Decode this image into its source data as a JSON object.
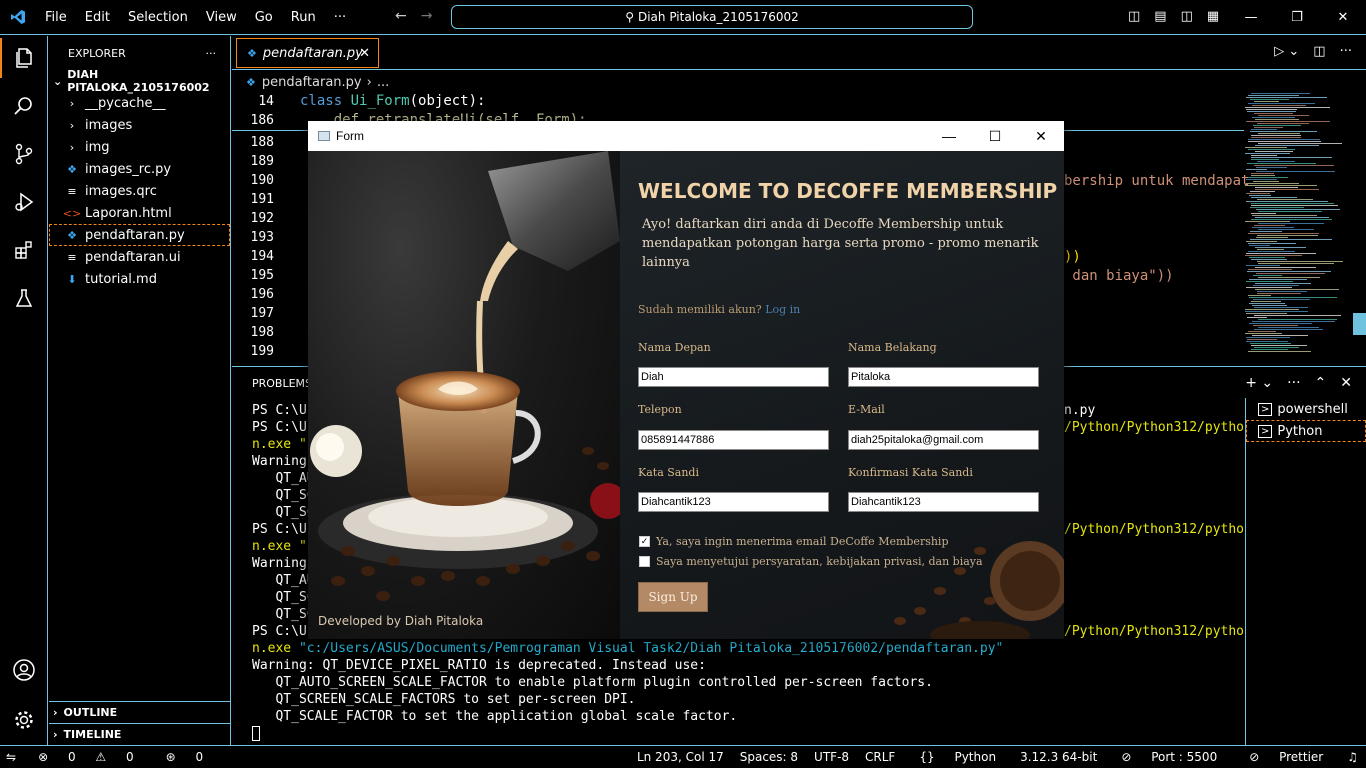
{
  "titlebar": {
    "menu": [
      "File",
      "Edit",
      "Selection",
      "View",
      "Go",
      "Run",
      "···"
    ],
    "search": "Diah Pitaloka_2105176002"
  },
  "explorer": {
    "header": "EXPLORER",
    "folder": "DIAH PITALOKA_2105176002",
    "items": [
      {
        "name": "__pycache__",
        "icon": "chevron-right"
      },
      {
        "name": "images",
        "icon": "chevron-right"
      },
      {
        "name": "img",
        "icon": "chevron-right"
      },
      {
        "name": "images_rc.py",
        "icon": "python"
      },
      {
        "name": "images.qrc",
        "icon": "lines"
      },
      {
        "name": "Laporan.html",
        "icon": "html"
      },
      {
        "name": "pendaftaran.py",
        "icon": "python"
      },
      {
        "name": "pendaftaran.ui",
        "icon": "lines"
      },
      {
        "name": "tutorial.md",
        "icon": "markdown"
      }
    ],
    "outline": "OUTLINE",
    "timeline": "TIMELINE"
  },
  "editor": {
    "tab": "pendaftaran.py",
    "breadcrumb_file": "pendaftaran.py",
    "breadcrumb_more": "...",
    "sticky": [
      {
        "line": "14",
        "code_kw": "class",
        "code_cls": "Ui_Form",
        "code_rest": "(object):"
      },
      {
        "line": "186",
        "code": "    def retranslateUi(self, Form):"
      }
    ],
    "lines": [
      "188",
      "189",
      "190",
      "191",
      "192",
      "193",
      "194",
      "195",
      "196",
      "197",
      "198",
      "199"
    ],
    "visible_code": {
      "l190": "bership untuk mendapat",
      "l194": "))",
      "l195": " dan biaya\"))"
    }
  },
  "panel": {
    "tab": "PROBLEMS",
    "terminal_left": [
      "PS C:\\Us",
      "PS C:\\Us",
      "n.exe \"c",
      "Warning:",
      "   QT_AU",
      "   QT_SC",
      "   QT_SC",
      "PS C:\\Us",
      "n.exe \"c",
      "Warning:",
      "   QT_AU",
      "   QT_SC",
      "   QT_SC",
      "PS C:\\Us"
    ],
    "terminal_right": {
      "r1": "n.py",
      "r2": "/Python/Python312/pytho",
      "r3": "/Python/Python312/pytho",
      "r4": "/Python/Python312/pytho"
    },
    "terminal_full": [
      "n.exe \"c:/Users/ASUS/Documents/Pemrograman Visual Task2/Diah Pitaloka_2105176002/pendaftaran.py\"",
      "Warning: QT_DEVICE_PIXEL_RATIO is deprecated. Instead use:",
      "   QT_AUTO_SCREEN_SCALE_FACTOR to enable platform plugin controlled per-screen factors.",
      "   QT_SCREEN_SCALE_FACTORS to set per-screen DPI.",
      "   QT_SCALE_FACTOR to set the application global scale factor."
    ],
    "terminals": [
      "powershell",
      "Python"
    ]
  },
  "status": {
    "errors": "0",
    "warnings": "0",
    "ports": "0",
    "position": "Ln 203, Col 17",
    "spaces": "Spaces: 8",
    "encoding": "UTF-8",
    "eol": "CRLF",
    "language": "Python",
    "interpreter": "3.12.3 64-bit",
    "port": "Port : 5500",
    "prettier": "Prettier"
  },
  "form": {
    "title": "Form",
    "heading": "WELCOME TO DECOFFE MEMBERSHIP",
    "subtitle_lines": [
      "Ayo! daftarkan diri anda di Decoffe Membership untuk",
      "mendapatkan potongan harga serta promo - promo menarik",
      "lainnya"
    ],
    "already_member": "Sudah memiliki akun?",
    "login_link": "Log in",
    "first_name_label": "Nama Depan",
    "first_name": "Diah",
    "last_name_label": "Nama Belakang",
    "last_name": "Pitaloka",
    "phone_label": "Telepon",
    "phone": "085891447886",
    "email_label": "E-Mail",
    "email": "diah25pitaloka@gmail.com",
    "password_label": "Kata Sandi",
    "password": "Diahcantik123",
    "confirm_label": "Konfirmasi Kata Sandi",
    "confirm": "Diahcantik123",
    "check_newsletter": "Ya, saya ingin menerima email DeCoffe Membership",
    "check_newsletter_checked": true,
    "check_terms": "Saya menyetujui persyaratan, kebijakan privasi, dan biaya",
    "check_terms_checked": false,
    "signup": "Sign Up",
    "developer": "Developed by Diah Pitaloka"
  }
}
